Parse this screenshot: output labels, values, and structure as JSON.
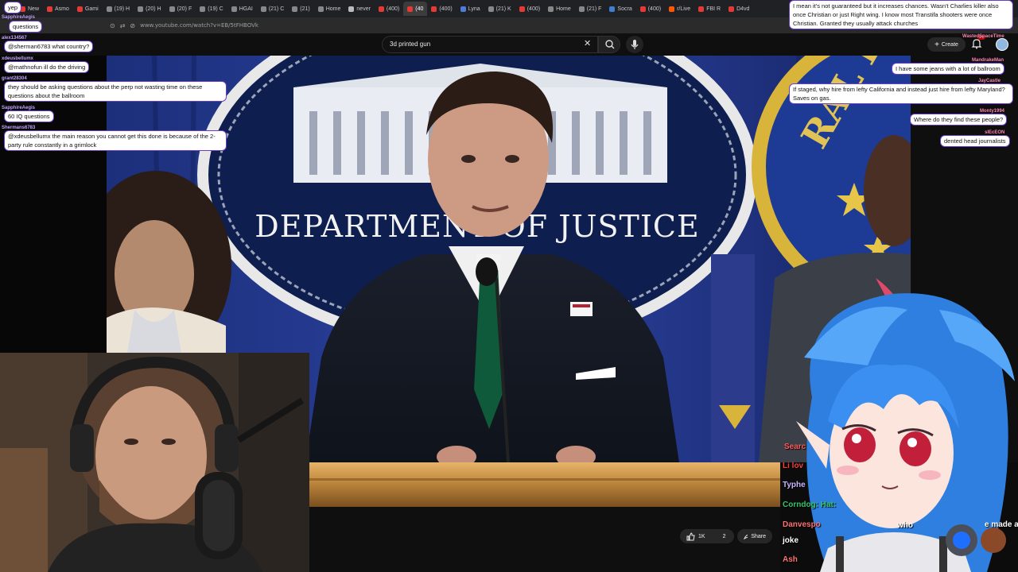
{
  "browser": {
    "tabs": [
      {
        "label": "New",
        "color": "#e53935"
      },
      {
        "label": "Asmo",
        "color": "#e53935"
      },
      {
        "label": "Gami",
        "color": "#e53935"
      },
      {
        "label": "(19) H",
        "color": "#888"
      },
      {
        "label": "(20) H",
        "color": "#888"
      },
      {
        "label": "(20) F",
        "color": "#888"
      },
      {
        "label": "(19) C",
        "color": "#888"
      },
      {
        "label": "HGAI",
        "color": "#888"
      },
      {
        "label": "(21) C",
        "color": "#888"
      },
      {
        "label": "(21)",
        "color": "#888"
      },
      {
        "label": "Home",
        "color": "#888"
      },
      {
        "label": "never",
        "color": "#bbb"
      },
      {
        "label": "(400)",
        "color": "#e53935"
      },
      {
        "label": "(40",
        "color": "#e53935"
      },
      {
        "label": "(400)",
        "color": "#e53935"
      },
      {
        "label": "Lyna",
        "color": "#4f7ad8"
      },
      {
        "label": "(21) K",
        "color": "#888"
      },
      {
        "label": "(400)",
        "color": "#e53935"
      },
      {
        "label": "Home",
        "color": "#888"
      },
      {
        "label": "(21) F",
        "color": "#888"
      },
      {
        "label": "Socra",
        "color": "#3f7fd0"
      },
      {
        "label": "(400)",
        "color": "#e53935"
      },
      {
        "label": "r/Live",
        "color": "#ff5700"
      },
      {
        "label": "FBI R",
        "color": "#e53935"
      },
      {
        "label": "D4vd",
        "color": "#e53935"
      }
    ],
    "url": "www.youtube.com/watch?v=EB/5tFHBOVk"
  },
  "youtube": {
    "search_value": "3d printed gun",
    "create_label": "Create",
    "notification_count": "9+"
  },
  "video_actions": {
    "like_count": "1K",
    "dislike_count": "2",
    "share_label": "Share"
  },
  "chat_left": [
    {
      "user": "",
      "text": "yep"
    },
    {
      "user": "SapphireAegis",
      "text": "questions"
    },
    {
      "user": "alex134567",
      "text": "@sherman6783 what country?"
    },
    {
      "user": "xdeusbellumx",
      "text": "@mathnofun ill do the driving"
    },
    {
      "user": "grant28304",
      "text": "they should be asking questions about the perp not wasting time on these questions about the ballroom"
    },
    {
      "user": "SapphireAegis",
      "text": "60 IQ questions"
    },
    {
      "user": "Shermans6783",
      "text": "@xdeusbellumx the main reason you cannot get this done is because of the 2-party rule constantly in a grimlock"
    }
  ],
  "chat_right": [
    {
      "user": "",
      "text": "I mean it's not guaranteed but it increases chances. Wasn't Charlies killer also once Christian or just Right wing. I know most Transtifa shooters were once Christian. Granted they usually attack churches"
    },
    {
      "user": "WastedSpaceTime",
      "text": ""
    },
    {
      "user": "MandrakeMan",
      "text": "I have some jeans with a lot of ballroom"
    },
    {
      "user": "JayCastle",
      "text": "If staged, why hire from lefty California and instead just hire from lefty Maryland? Saves on gas."
    },
    {
      "user": "Monty1994",
      "text": "Where do they find these people?"
    },
    {
      "user": "sIEcEON",
      "text": "dented head journalists"
    }
  ],
  "chat_overlay_lower": [
    {
      "text": "Searc",
      "color": "#ff5a5a"
    },
    {
      "text": "Li lov",
      "color": "#ff3b3b"
    },
    {
      "text": "Typhe",
      "color": "#c9b3ff"
    },
    {
      "text": "Corndog: Hat:",
      "color": "#36c46a"
    },
    {
      "text": "Danvespo",
      "color": "#ff7070"
    },
    {
      "text": "joke",
      "color": "#ffffff"
    },
    {
      "text": "Ash",
      "color": "#ff7070"
    },
    {
      "text": "e made a",
      "color": "#ffffff"
    },
    {
      "text": "who",
      "color": "#ffffff"
    }
  ],
  "video_sign": {
    "title": "DEPARTMENT OF JUSTICE",
    "seal_text": "RAL BUREAU"
  },
  "colors": {
    "chat_border": "#6a3dc8",
    "video_backdrop": "#1b2d6b",
    "accent_red": "#cc0000"
  }
}
